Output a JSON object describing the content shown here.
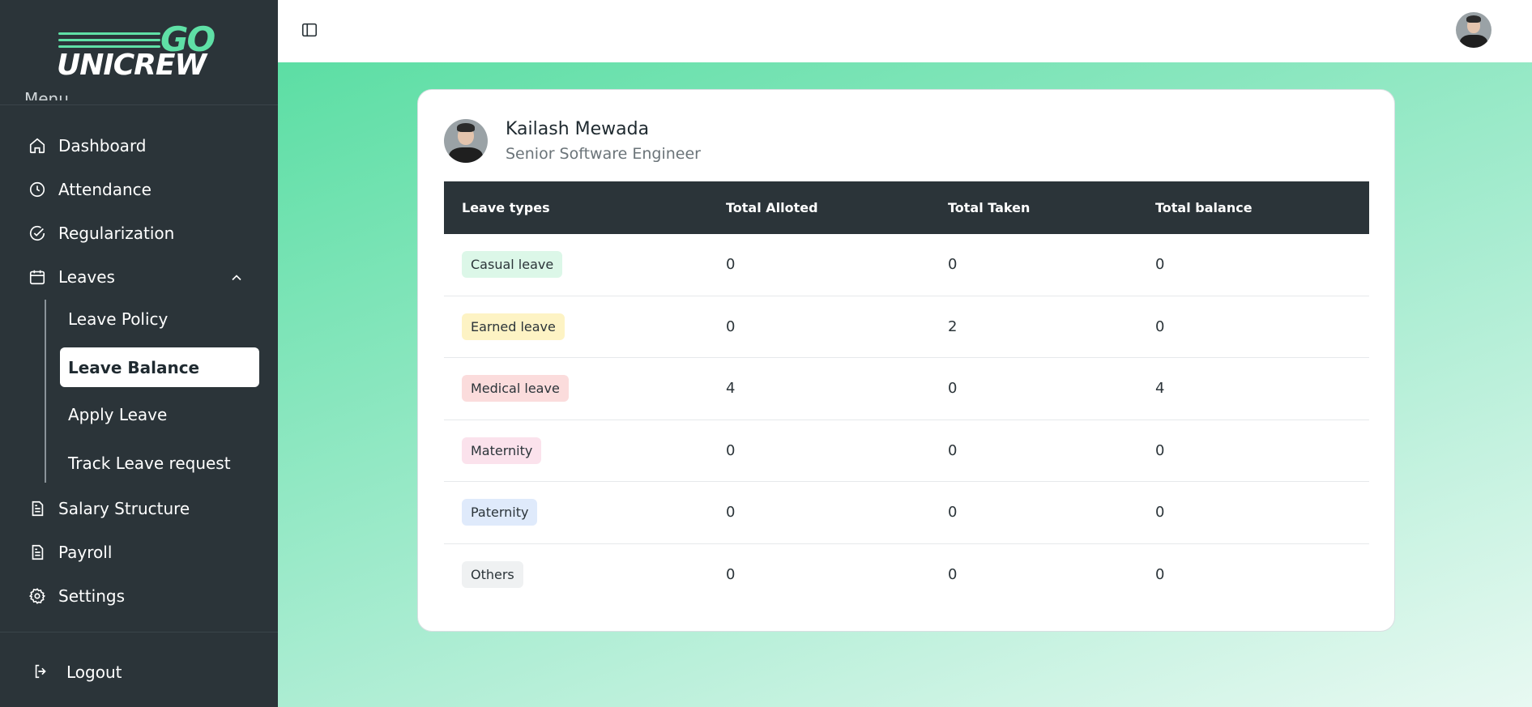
{
  "logo": {
    "go": "GO",
    "unicrew": "UNICREW"
  },
  "sidebar": {
    "section_label": "Menu",
    "items": [
      {
        "label": "Dashboard",
        "icon": "home-icon"
      },
      {
        "label": "Attendance",
        "icon": "clock-icon"
      },
      {
        "label": "Regularization",
        "icon": "check-circle-icon"
      },
      {
        "label": "Leaves",
        "icon": "calendar-icon"
      },
      {
        "label": "Salary Structure",
        "icon": "document-icon"
      },
      {
        "label": "Payroll",
        "icon": "document-icon"
      },
      {
        "label": "Settings",
        "icon": "gear-icon"
      }
    ],
    "leaves_sub": [
      {
        "label": "Leave Policy"
      },
      {
        "label": "Leave Balance",
        "active": true
      },
      {
        "label": "Apply Leave"
      },
      {
        "label": "Track Leave request"
      }
    ],
    "logout": "Logout"
  },
  "profile": {
    "name": "Kailash Mewada",
    "role": "Senior Software Engineer"
  },
  "table": {
    "headers": [
      "Leave types",
      "Total Alloted",
      "Total Taken",
      "Total balance"
    ],
    "rows": [
      {
        "type": "Casual leave",
        "color": "#dcf7e8",
        "alloted": "0",
        "taken": "0",
        "balance": "0"
      },
      {
        "type": "Earned leave",
        "color": "#fdf3c4",
        "alloted": "0",
        "taken": "2",
        "balance": "0"
      },
      {
        "type": "Medical leave",
        "color": "#fbdcdc",
        "alloted": "4",
        "taken": "0",
        "balance": "4"
      },
      {
        "type": "Maternity",
        "color": "#fbe2ec",
        "alloted": "0",
        "taken": "0",
        "balance": "0"
      },
      {
        "type": "Paternity",
        "color": "#dfeafb",
        "alloted": "0",
        "taken": "0",
        "balance": "0"
      },
      {
        "type": "Others",
        "color": "#eff1f2",
        "alloted": "0",
        "taken": "0",
        "balance": "0"
      }
    ]
  },
  "colors": {
    "sidebar": "#2b3439",
    "accent": "#5fe0a6"
  }
}
